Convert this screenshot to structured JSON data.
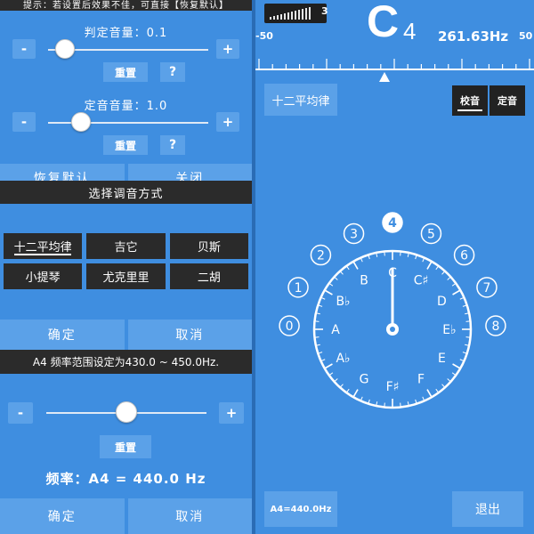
{
  "colors": {
    "accent": "#3f8ee0",
    "button": "#5ba1e8",
    "dark": "#2a2a2a"
  },
  "settings": {
    "hint": "提示：若设置后效果不佳，可直接【恢复默认】",
    "judge_volume_label": "判定音量：0.1",
    "judge_volume_value": 0.1,
    "pitch_volume_label": "定音音量：1.0",
    "pitch_volume_value": 1.0,
    "minus": "-",
    "plus": "+",
    "reset": "重置",
    "help": "?",
    "restore_default": "恢复默认",
    "close": "关闭"
  },
  "tuning_method": {
    "title": "选择调音方式",
    "options": [
      "十二平均律",
      "吉它",
      "贝斯",
      "小提琴",
      "尤克里里",
      "二胡"
    ],
    "selected": "十二平均律",
    "confirm": "确定",
    "cancel": "取消"
  },
  "a4_frequency": {
    "range_text": "A4 频率范围设定为430.0 ~ 450.0Hz.",
    "minus": "-",
    "plus": "+",
    "reset": "重置",
    "value_label": "频率：A4 = 440.0 Hz",
    "value": 440.0,
    "min": 430.0,
    "max": 450.0,
    "confirm": "确定",
    "cancel": "取消"
  },
  "tuner": {
    "level_value": "3",
    "note": "C",
    "octave": "4",
    "frequency": "261.63Hz",
    "scale_min": "-50",
    "scale_max": "50",
    "mode_button": "十二平均律",
    "tab_tune": "校音",
    "tab_pitch": "定音",
    "octaves": [
      "0",
      "1",
      "2",
      "3",
      "4",
      "5",
      "6",
      "7",
      "8"
    ],
    "selected_octave": "4",
    "dial_notes": [
      "C",
      "C♯",
      "D",
      "E♭",
      "E",
      "F",
      "F♯",
      "G",
      "A♭",
      "A",
      "B♭",
      "B"
    ],
    "a4_button": "A4=440.0Hz",
    "exit_button": "退出"
  }
}
